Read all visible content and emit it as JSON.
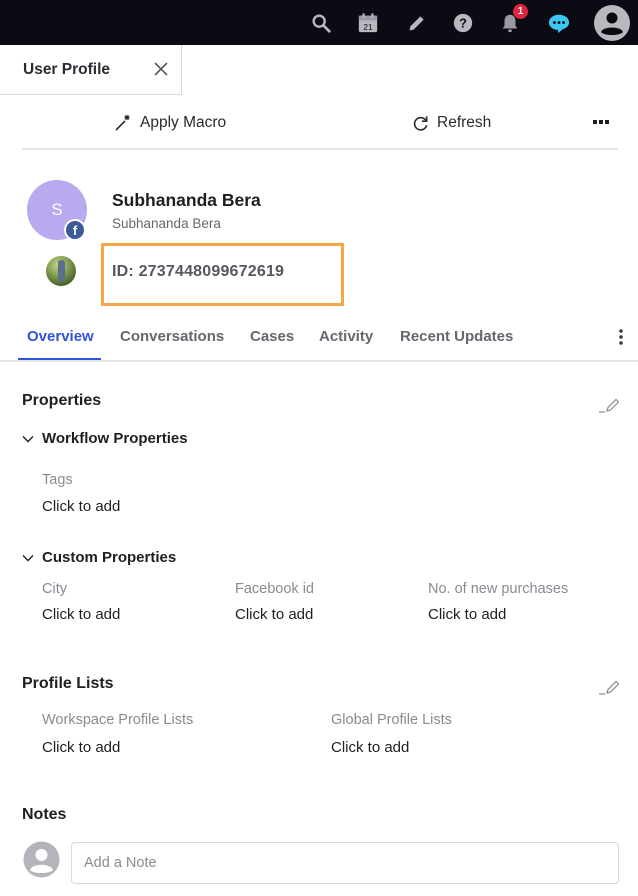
{
  "topbar": {
    "icons": [
      "search-icon",
      "calendar-icon",
      "pencil-icon",
      "help-icon",
      "bell-icon",
      "chat-icon",
      "user-avatar-icon"
    ],
    "calendar_day": "21",
    "notification_count": "1",
    "colors": {
      "background": "#0b0b14",
      "icon": "#b8b8bf",
      "chat": "#3cc7f0",
      "badge": "#e0243c"
    }
  },
  "doc_tab": {
    "title": "User Profile"
  },
  "toolbar": {
    "apply_macro_label": "Apply Macro",
    "refresh_label": "Refresh"
  },
  "profile": {
    "initial": "S",
    "name": "Subhananda Bera",
    "username": "Subhananda Bera",
    "network_badge": "f",
    "id_text": "ID: 2737448099672619",
    "colors": {
      "avatar": "#b9a9ef",
      "facebook": "#3d5a98",
      "highlight_box": "#f5a74a"
    }
  },
  "tabs": [
    {
      "label": "Overview",
      "active": true
    },
    {
      "label": "Conversations",
      "active": false
    },
    {
      "label": "Cases",
      "active": false
    },
    {
      "label": "Activity",
      "active": false
    },
    {
      "label": "Recent Updates",
      "active": false
    }
  ],
  "properties": {
    "title": "Properties",
    "workflow": {
      "title": "Workflow Properties",
      "fields": [
        {
          "label": "Tags",
          "value": "Click to add"
        }
      ]
    },
    "custom": {
      "title": "Custom Properties",
      "fields": [
        {
          "label": "City",
          "value": "Click to add"
        },
        {
          "label": "Facebook id",
          "value": "Click to add"
        },
        {
          "label": "No. of new purchases",
          "value": "Click to add"
        }
      ]
    }
  },
  "profile_lists": {
    "title": "Profile Lists",
    "fields": [
      {
        "label": "Workspace Profile Lists",
        "value": "Click to add"
      },
      {
        "label": "Global Profile Lists",
        "value": "Click to add"
      }
    ]
  },
  "notes": {
    "title": "Notes",
    "placeholder": "Add a Note"
  }
}
